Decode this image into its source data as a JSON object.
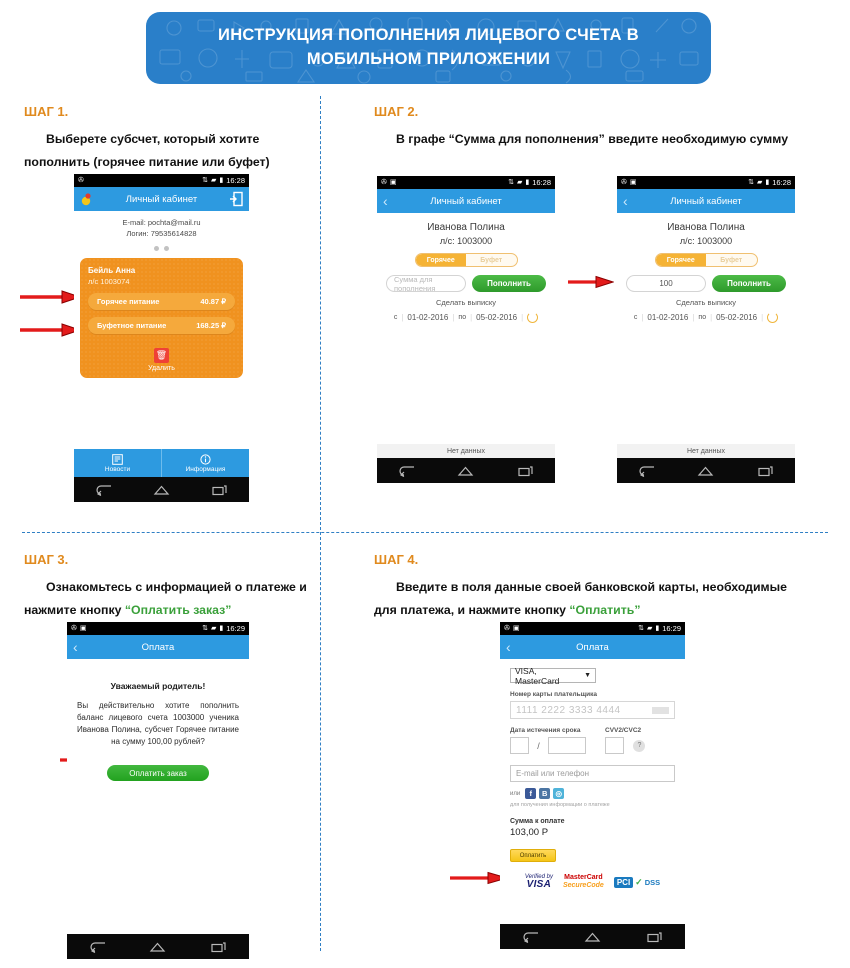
{
  "banner": {
    "title": "ИНСТРУКЦИЯ ПОПОЛНЕНИЯ ЛИЦЕВОГО СЧЕТА В МОБИЛЬНОМ ПРИЛОЖЕНИИ",
    "bg_color": "#2a7fc9",
    "text_color": "#ffffff"
  },
  "colors": {
    "step_label": "#e08a1e",
    "separator": "#2f7fc4",
    "arrow": "#e31b1b",
    "appbar": "#2d9ae0",
    "card_orange": "#f0921f",
    "green_button": "#3aa03a",
    "yellow_button": "#f5c518"
  },
  "steps": [
    {
      "label": "ШАГ 1.",
      "line1": "Выберете субсчет, который хотите",
      "line2": "пополнить (горячее питание или буфет)"
    },
    {
      "label": "ШАГ 2.",
      "line1": "В графе “Сумма для пополнения” введите необходимую сумму"
    },
    {
      "label": "ШАГ 3.",
      "line1": "Ознакомьтесь с информацией о платеже и",
      "line2_pre": "нажмите кнопку ",
      "line2_hl": "“Оплатить заказ”"
    },
    {
      "label": "ШАГ 4.",
      "line1": "Введите в поля данные своей банковской карты, необходимые",
      "line2_pre": "для платежа, и нажмите  кнопку ",
      "line2_hl": "“Оплатить”"
    }
  ],
  "phone1": {
    "status_time": "16:28",
    "appbar_title": "Личный кабинет",
    "email": "E-mail: pochta@mail.ru",
    "login": "Логин: 79535614828",
    "card": {
      "name": "Бейль Анна",
      "account": "л/с 1003074",
      "rows": [
        {
          "label": "Горячее питание",
          "amount": "40.87 ₽"
        },
        {
          "label": "Буфетное питание",
          "amount": "168.25 ₽"
        }
      ],
      "delete_label": "Удалить"
    },
    "tabs": [
      {
        "label": "Новости",
        "icon": "news-icon"
      },
      {
        "label": "Информация",
        "icon": "info-icon"
      }
    ]
  },
  "phone2": {
    "status_time": "16:28",
    "appbar_title": "Личный кабинет",
    "name": "Иванова Полина",
    "account": "л/с: 1003000",
    "segment": {
      "active": "Горячее",
      "inactive": "Буфет"
    },
    "amount_placeholder": "Сумма для пополнения",
    "amount_value": "",
    "topup_button": "Пополнить",
    "statement_label": "Сделать выписку",
    "date_from_label": "с",
    "date_from": "01-02-2016",
    "date_to_label": "по",
    "date_to": "05-02-2016",
    "no_data": "Нет данных"
  },
  "phone3": {
    "status_time": "16:28",
    "appbar_title": "Личный кабинет",
    "name": "Иванова Полина",
    "account": "л/с: 1003000",
    "segment": {
      "active": "Горячее",
      "inactive": "Буфет"
    },
    "amount_placeholder": "",
    "amount_value": "100",
    "topup_button": "Пополнить",
    "statement_label": "Сделать выписку",
    "date_from_label": "с",
    "date_from": "01-02-2016",
    "date_to_label": "по",
    "date_to": "05-02-2016",
    "no_data": "Нет данных"
  },
  "phone4": {
    "status_time": "16:29",
    "appbar_title": "Оплата",
    "heading": "Уважаемый родитель!",
    "body": "Вы действительно хотите пополнить баланс лицевого счета 1003000 ученика Иванова Полина, субсчет Горячее питание на сумму 100,00 рублей?",
    "pay_button": "Оплатить заказ"
  },
  "phone5": {
    "status_time": "16:29",
    "appbar_title": "Оплата",
    "card_type": "VISA, MasterCard",
    "card_number_label": "Номер карты плательщика",
    "card_number_value": "1111  2222  3333  4444",
    "expiry_label": "Дата истечения срока",
    "expiry_month": "",
    "expiry_year": "",
    "cvv_label": "CVV2/CVC2",
    "cvv_value": "",
    "help_glyph": "?",
    "contact_placeholder": "E-mail или телефон",
    "social_or": "или",
    "social_icons": [
      {
        "name": "facebook-icon",
        "glyph": "f"
      },
      {
        "name": "vk-icon",
        "glyph": "В"
      },
      {
        "name": "odnoklassniki-icon",
        "glyph": "◎"
      }
    ],
    "social_note": "для получения информации о платеже",
    "total_label": "Сумма к оплате",
    "total_value": "103,00 Р",
    "pay_button": "Оплатить",
    "logos": {
      "visa_line1": "Verified by",
      "visa_line2": "VISA",
      "mc_line1": "MasterCard",
      "mc_line2": "SecureCode",
      "pci_box": "PCI",
      "pci_dss": "DSS"
    }
  }
}
